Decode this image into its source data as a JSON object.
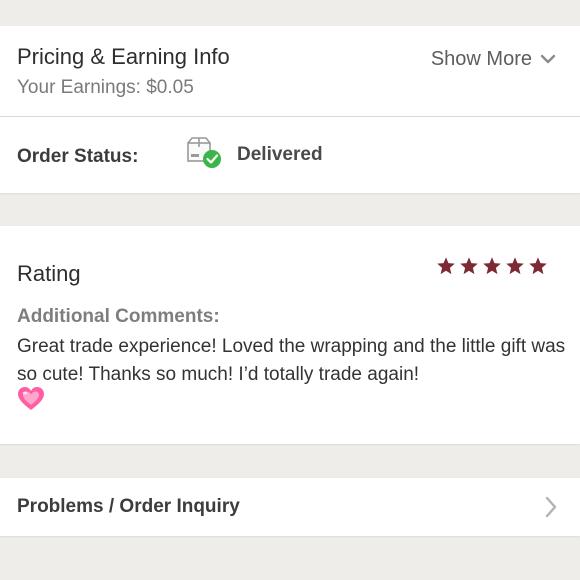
{
  "pricing": {
    "title": "Pricing & Earning Info",
    "earnings": "Your Earnings: $0.05",
    "show_more": "Show More"
  },
  "order_status": {
    "label": "Order Status:",
    "value": "Delivered",
    "icon": "package-delivered-icon"
  },
  "rating": {
    "title": "Rating",
    "stars": 5,
    "star_color": "#7d2a35",
    "comments_label": "Additional Comments:",
    "comment": "Great trade experience! Loved the wrapping and the little gift was so cute! Thanks so much! I’d totally trade again!"
  },
  "problems": {
    "label": "Problems / Order Inquiry"
  },
  "colors": {
    "background": "#efede9",
    "check_green": "#3bb54a",
    "heart_pink": "#ff5fa2"
  }
}
